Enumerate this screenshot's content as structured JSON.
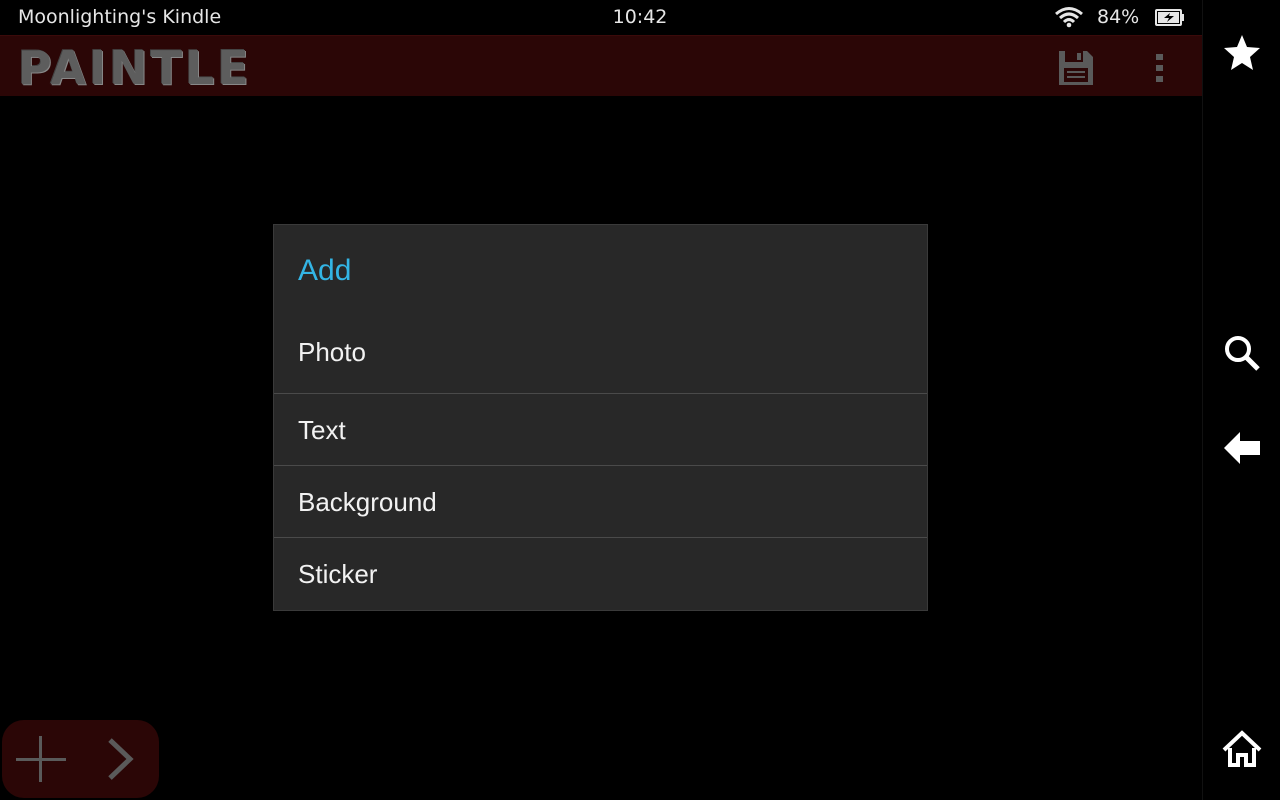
{
  "status_bar": {
    "device_name": "Moonlighting's Kindle",
    "time": "10:42",
    "battery_percent": "84%",
    "wifi_icon": "wifi-icon",
    "battery_icon": "battery-charging-icon"
  },
  "app_bar": {
    "logo": "PAINTLE",
    "save_icon": "save-icon",
    "overflow_icon": "overflow-menu-icon",
    "background_color": "#2b0606"
  },
  "dialog": {
    "title": "Add",
    "title_color": "#33b5e5",
    "items": [
      {
        "label": "Photo"
      },
      {
        "label": "Text"
      },
      {
        "label": "Background"
      },
      {
        "label": "Sticker"
      }
    ]
  },
  "bottom_toolbar": {
    "add_icon": "plus-icon",
    "next_icon": "chevron-right-icon"
  },
  "system_nav": {
    "icons": [
      "star-icon",
      "search-icon",
      "back-arrow-icon",
      "home-icon"
    ]
  }
}
